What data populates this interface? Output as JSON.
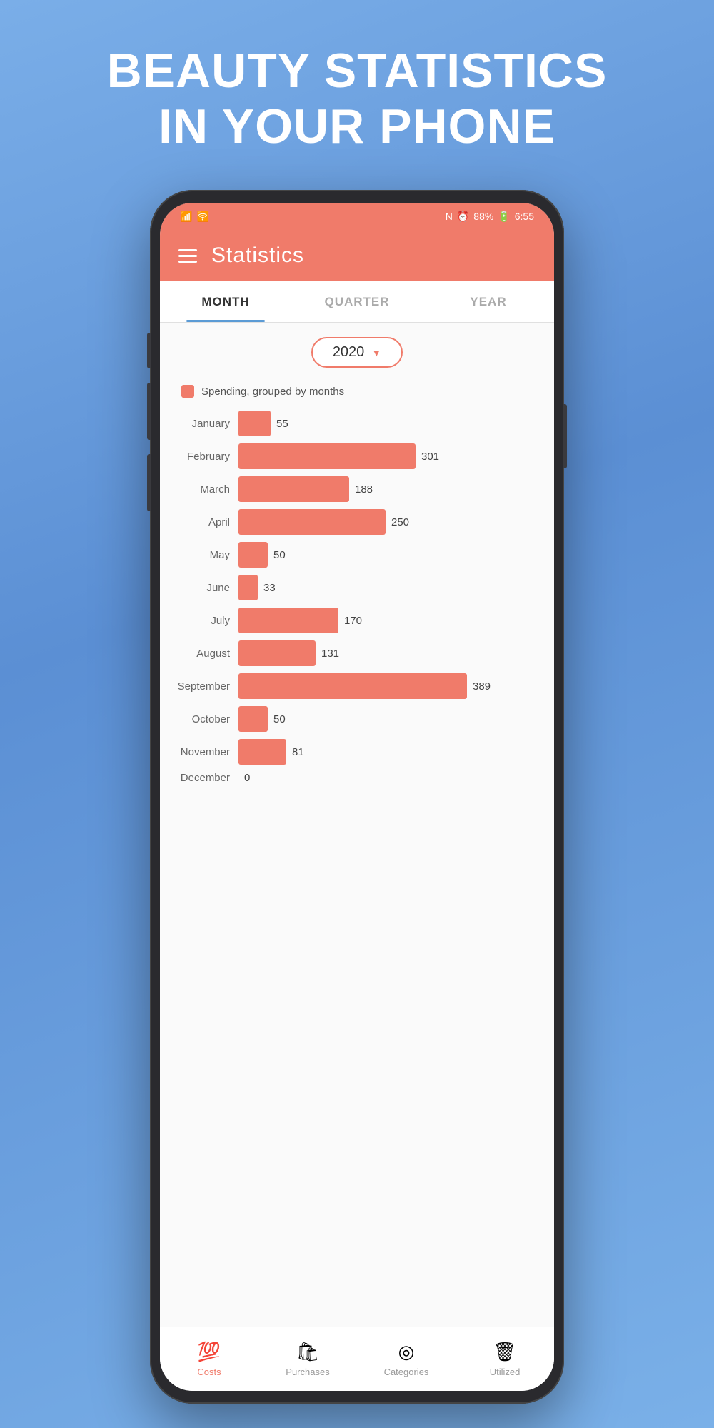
{
  "hero": {
    "title_line1": "BEAUTY STATISTICS",
    "title_line2": "IN YOUR PHONE"
  },
  "status_bar": {
    "time": "6:55",
    "battery": "88%"
  },
  "header": {
    "title": "Statistics"
  },
  "tabs": [
    {
      "label": "MONTH",
      "active": true
    },
    {
      "label": "QUARTER",
      "active": false
    },
    {
      "label": "YEAR",
      "active": false
    }
  ],
  "year_selector": {
    "year": "2020"
  },
  "legend": {
    "text": "Spending, grouped by months"
  },
  "chart": {
    "max_value": 389,
    "bars": [
      {
        "month": "January",
        "value": 55
      },
      {
        "month": "February",
        "value": 301
      },
      {
        "month": "March",
        "value": 188
      },
      {
        "month": "April",
        "value": 250
      },
      {
        "month": "May",
        "value": 50
      },
      {
        "month": "June",
        "value": 33
      },
      {
        "month": "July",
        "value": 170
      },
      {
        "month": "August",
        "value": 131
      },
      {
        "month": "September",
        "value": 389
      },
      {
        "month": "October",
        "value": 50
      },
      {
        "month": "November",
        "value": 81
      },
      {
        "month": "December",
        "value": 0
      }
    ]
  },
  "bottom_nav": [
    {
      "label": "Costs",
      "icon": "💯",
      "active": true
    },
    {
      "label": "Purchases",
      "icon": "🛍",
      "active": false
    },
    {
      "label": "Categories",
      "icon": "◎",
      "active": false
    },
    {
      "label": "Utilized",
      "icon": "🗑",
      "active": false
    }
  ]
}
